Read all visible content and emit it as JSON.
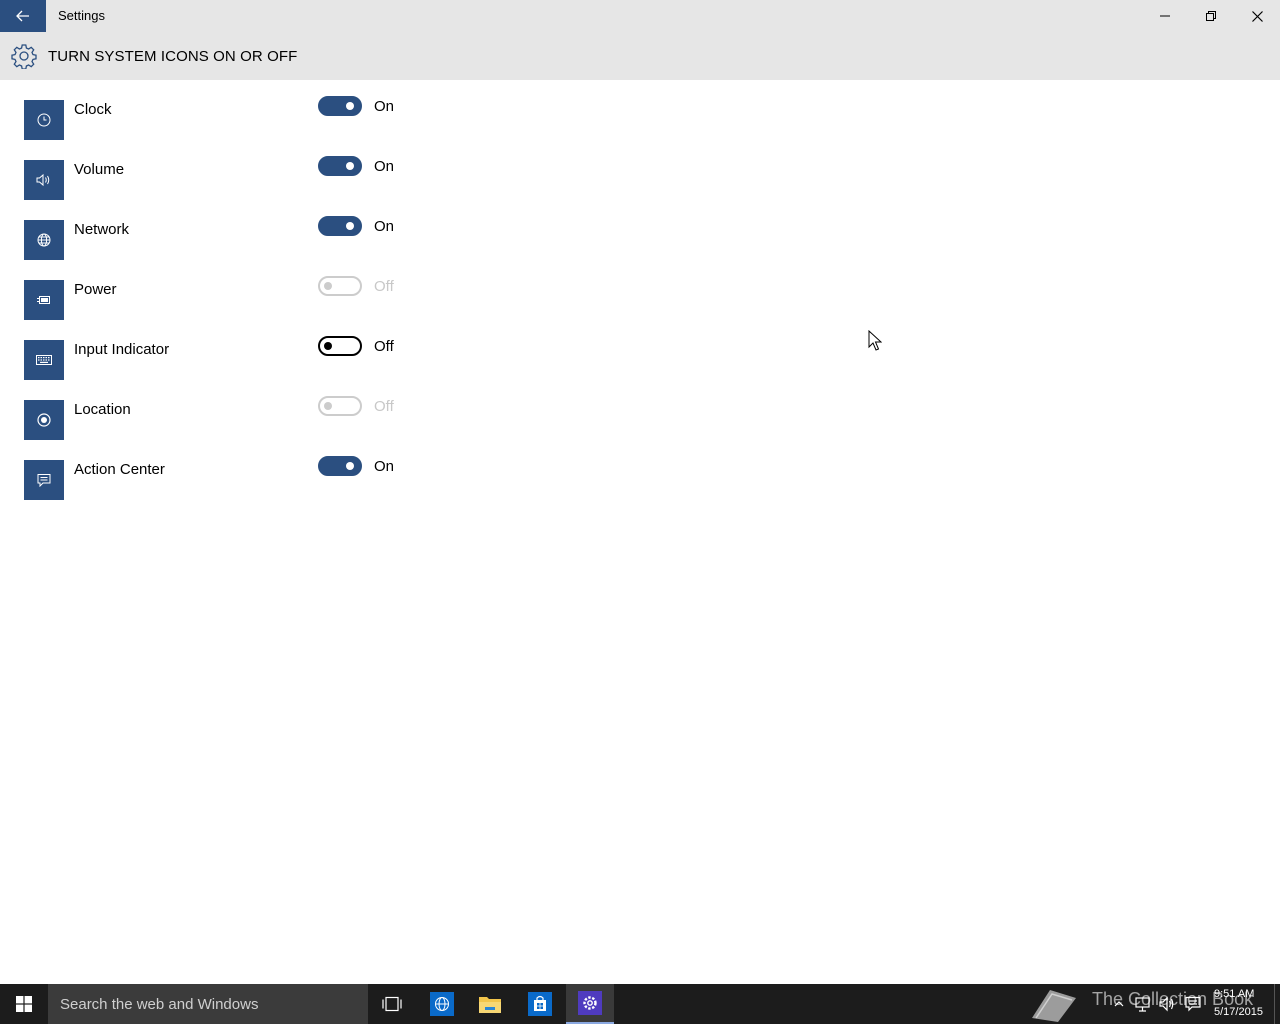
{
  "window": {
    "title": "Settings"
  },
  "header": {
    "title": "TURN SYSTEM ICONS ON OR OFF"
  },
  "settings": [
    {
      "label": "Clock",
      "icon": "clock-icon",
      "state": "On",
      "enabled": true
    },
    {
      "label": "Volume",
      "icon": "volume-icon",
      "state": "On",
      "enabled": true
    },
    {
      "label": "Network",
      "icon": "network-icon",
      "state": "On",
      "enabled": true
    },
    {
      "label": "Power",
      "icon": "power-icon",
      "state": "Off",
      "enabled": false
    },
    {
      "label": "Input Indicator",
      "icon": "keyboard-icon",
      "state": "Off",
      "enabled": true
    },
    {
      "label": "Location",
      "icon": "location-icon",
      "state": "Off",
      "enabled": false
    },
    {
      "label": "Action Center",
      "icon": "action-center-icon",
      "state": "On",
      "enabled": true
    }
  ],
  "taskbar": {
    "search_placeholder": "Search the web and Windows",
    "watermark": "The Collection Book",
    "time": "9:51 AM",
    "date": "5/17/2015"
  },
  "colors": {
    "accent": "#2b4f80",
    "chrome": "#e6e6e6",
    "taskbar": "#1c1c1c"
  }
}
